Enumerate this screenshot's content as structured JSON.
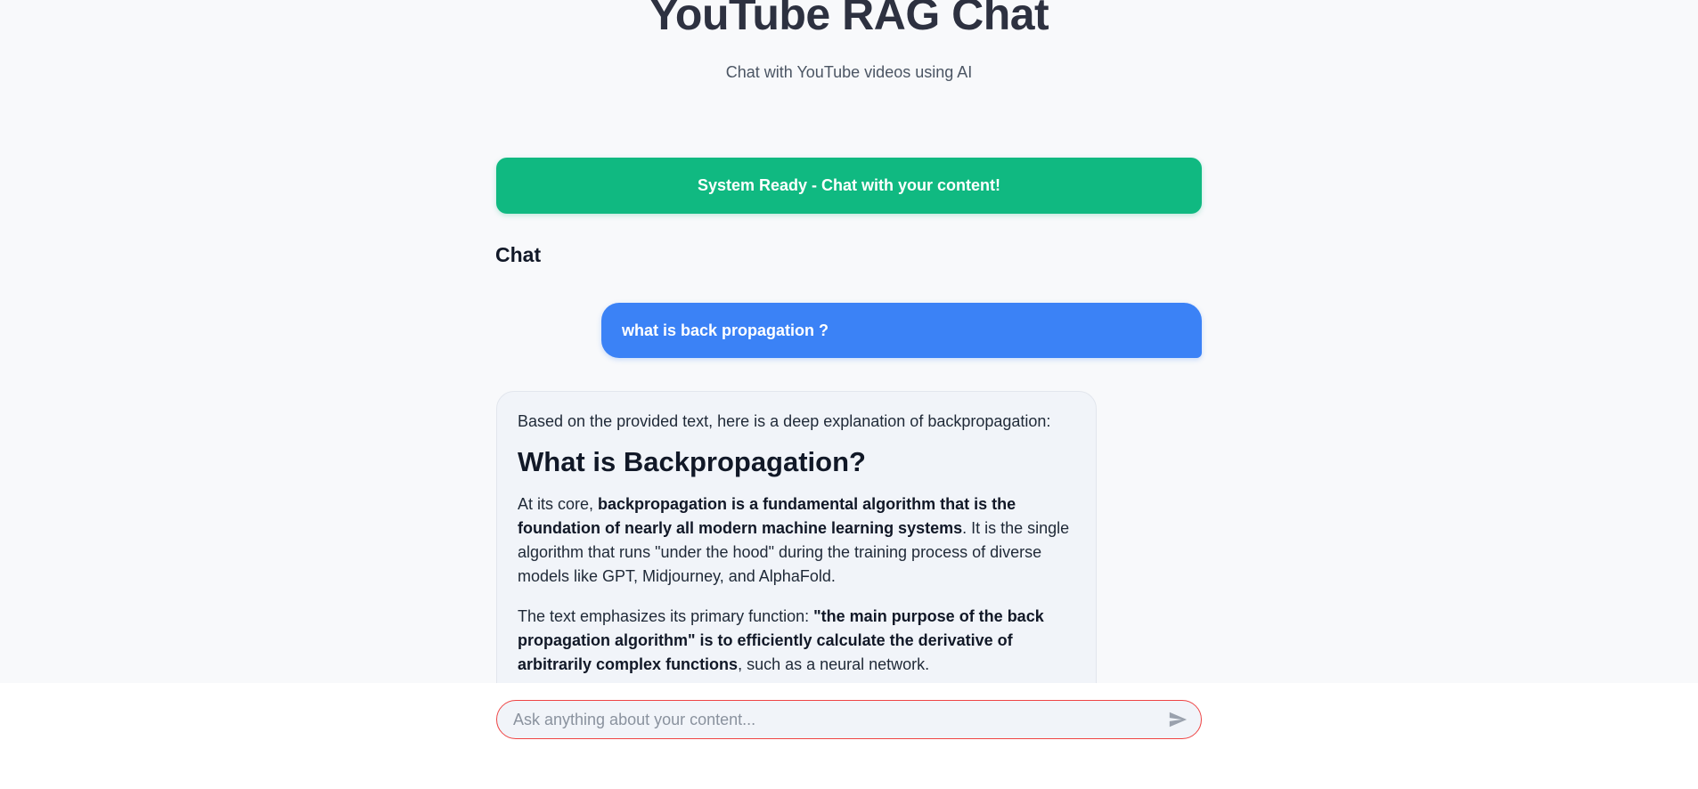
{
  "header": {
    "title": "YouTube RAG Chat",
    "subtitle": "Chat with YouTube videos using AI"
  },
  "status": {
    "text": "System Ready - Chat with your content!",
    "color": "#10b981"
  },
  "chat": {
    "heading": "Chat",
    "user_message": "what is back propagation ?",
    "assistant": {
      "intro": "Based on the provided text, here is a deep explanation of backpropagation:",
      "heading": "What is Backpropagation?",
      "p1_a": "At its core, ",
      "p1_b": "backpropagation is a fundamental algorithm that is the foundation of nearly all modern machine learning systems",
      "p1_c": ". It is the single algorithm that runs \"under the hood\" during the training process of diverse models like GPT, Midjourney, and AlphaFold.",
      "p2_a": "The text emphasizes its primary function: ",
      "p2_b": "\"the main purpose of the back propagation algorithm\" is to efficiently calculate the derivative of arbitrarily complex functions",
      "p2_c": ", such as a neural network."
    }
  },
  "input": {
    "placeholder": "Ask anything about your content...",
    "value": "",
    "send_icon": "send-icon"
  },
  "colors": {
    "user_bubble": "#3b82f6",
    "input_border": "#ef4444"
  }
}
